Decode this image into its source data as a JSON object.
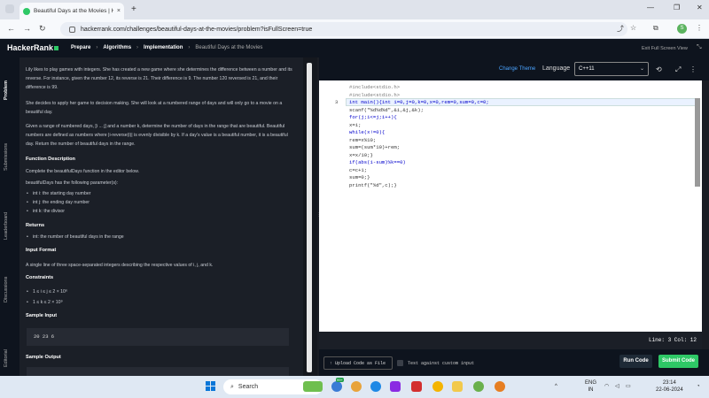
{
  "browser": {
    "tab_title": "Beautiful Days at the Movies | H",
    "tab_close": "×",
    "new_tab": "+",
    "url": "hackerrank.com/challenges/beautiful-days-at-the-movies/problem?isFullScreen=true",
    "profile": "S"
  },
  "header": {
    "logo": "HackerRank",
    "breadcrumbs": [
      "Prepare",
      "Algorithms",
      "Implementation",
      "Beautiful Days at the Movies"
    ],
    "exit_fullscreen": "Exit Full Screen View"
  },
  "sidebar": {
    "items": [
      "Problem",
      "Submissions",
      "Leaderboard",
      "Discussions",
      "Editorial"
    ]
  },
  "problem": {
    "para1": "Lily likes to play games with integers. She has created a new game where she determines the difference between a number and its reverse. For instance, given the number 12, its reverse is 21. Their difference is 9. The number 120 reversed is 21, and their difference is 99.",
    "para2": "She decides to apply her game to decision making. She will look at a numbered range of days and will only go to a movie on a beautiful day.",
    "para3": "Given a range of numbered days, [i ... j] and a number k, determine the number of days in the range that are beautiful. Beautiful numbers are defined as numbers where |i-reverse(i)| is evenly divisible by k. If a day's value is a beautiful number, it is a beautiful day. Return the number of beautiful days in the range.",
    "func_desc_title": "Function Description",
    "func_desc": "Complete the beautifulDays function in the editor below.",
    "params_intro": "beautifulDays has the following parameter(s):",
    "params": [
      "int i: the starting day number",
      "int j: the ending day number",
      "int k: the divisor"
    ],
    "returns_title": "Returns",
    "returns": [
      "int: the number of beautiful days in the range"
    ],
    "input_title": "Input Format",
    "input_desc": "A single line of three space-separated integers describing the respective values of i, j, and k.",
    "constraints_title": "Constraints",
    "constraints": [
      "1 ≤ i ≤ j ≤ 2 × 10⁶",
      "1 ≤ k ≤ 2 × 10⁹"
    ],
    "sample_input_title": "Sample Input",
    "sample_input": "20 23 6",
    "sample_output_title": "Sample Output"
  },
  "editor": {
    "change_theme": "Change Theme",
    "language_label": "Language",
    "language": "C++11",
    "current_line_number": "3",
    "code_lines": [
      "#include<stdio.h>",
      "#include<stdio.h>",
      "int main(){int i=0,j=0,k=0,x=0,rem=0,sum=0,c=0;",
      "scanf(\"%d%d%d\",&i,&j,&k);",
      "for(j;i<=j;i++){",
      "x=i;",
      "while(x!=0){",
      "rem=x%10;",
      "sum=(sum*10)+rem;",
      "x=x/10;}",
      "if(abs(i-sum)%k==0)",
      "c=c+1;",
      "sum=0;}",
      "printf(\"%d\",c);}"
    ],
    "status": "Line: 3 Col: 12"
  },
  "actions": {
    "upload": "↑ Upload Code as File",
    "custom_input": "Test against custom input",
    "run": "Run Code",
    "submit": "Submit Code"
  },
  "taskbar": {
    "search_placeholder": "Search",
    "lang_top": "ENG",
    "lang_bottom": "IN",
    "time": "23:14",
    "date": "22-06-2024",
    "badge": "99+"
  },
  "colors": {
    "accent": "#2ec866",
    "link": "#4aa3ff",
    "panel": "#1b1f27"
  }
}
